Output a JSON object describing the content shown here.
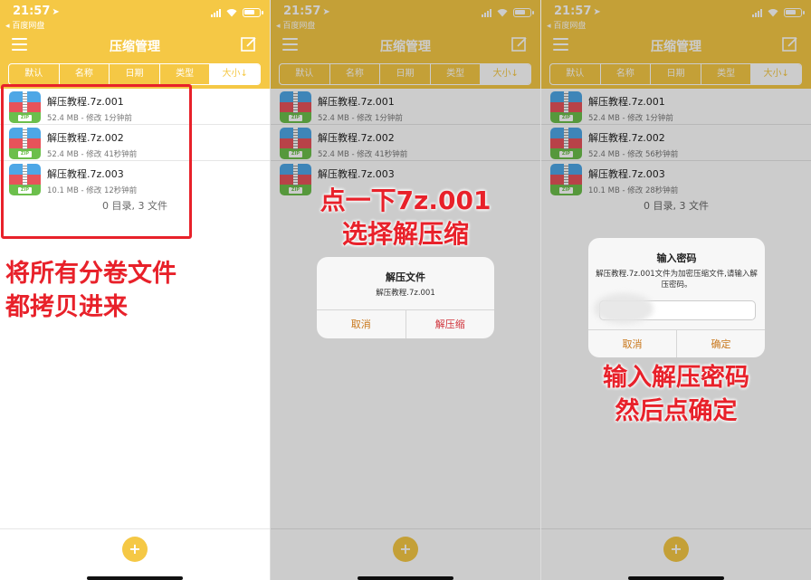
{
  "status": {
    "time": "21:57",
    "back_link": "◂ 百度网盘"
  },
  "header": {
    "title": "压缩管理"
  },
  "tabs": [
    "默认",
    "名称",
    "日期",
    "类型",
    "大小↓"
  ],
  "zip_tag": "ZIP",
  "panels": [
    {
      "files": [
        {
          "name": "解压教程.7z.001",
          "meta": "52.4 MB - 修改 1分钟前"
        },
        {
          "name": "解压教程.7z.002",
          "meta": "52.4 MB - 修改 41秒钟前"
        },
        {
          "name": "解压教程.7z.003",
          "meta": "10.1 MB - 修改 12秒钟前"
        }
      ],
      "summary": "0 目录, 3 文件",
      "annotation": [
        "将所有分卷文件",
        "都拷贝进来"
      ]
    },
    {
      "files": [
        {
          "name": "解压教程.7z.001",
          "meta": "52.4 MB - 修改 1分钟前"
        },
        {
          "name": "解压教程.7z.002",
          "meta": "52.4 MB - 修改 41秒钟前"
        },
        {
          "name": "解压教程.7z.003",
          "meta": ""
        }
      ],
      "annotation": [
        "点一下7z.001",
        "选择解压缩"
      ],
      "alert": {
        "title": "解压文件",
        "message": "解压教程.7z.001",
        "cancel": "取消",
        "confirm": "解压缩"
      }
    },
    {
      "files": [
        {
          "name": "解压教程.7z.001",
          "meta": "52.4 MB - 修改 1分钟前"
        },
        {
          "name": "解压教程.7z.002",
          "meta": "52.4 MB - 修改 56秒钟前"
        },
        {
          "name": "解压教程.7z.003",
          "meta": "10.1 MB - 修改 28秒钟前"
        }
      ],
      "summary": "0 目录, 3 文件",
      "annotation": [
        "输入解压密码",
        "然后点确定"
      ],
      "alert": {
        "title": "输入密码",
        "message": "解压教程.7z.001文件为加密压缩文件,请输入解压密码。",
        "input_value": "",
        "cancel": "取消",
        "confirm": "确定"
      }
    }
  ],
  "fab": {
    "label": "+"
  },
  "colors": {
    "accent": "#f5c845",
    "annotation": "#e8212a",
    "alert_button": "#c9771b"
  }
}
